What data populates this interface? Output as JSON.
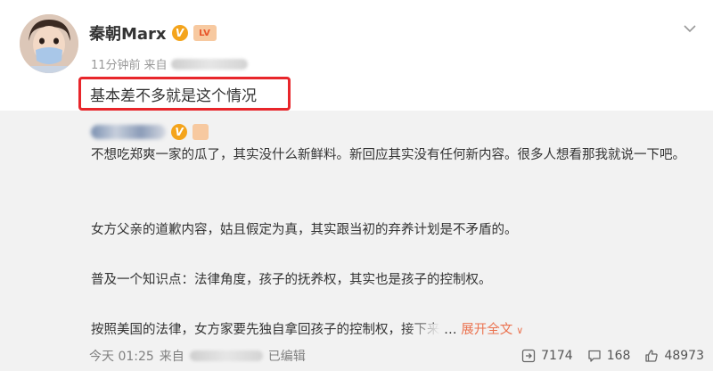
{
  "post": {
    "author": "秦朝Marx",
    "verified_badge": "V",
    "level_badge": "LV",
    "time": "11分钟前",
    "source_prefix": "来自",
    "text": "基本差不多就是这个情况",
    "menu_icon": "chevron-down-icon"
  },
  "repost": {
    "author_badge": "V",
    "paragraphs": [
      "不想吃郑爽一家的瓜了，其实没什么新鲜料。新回应其实没有任何新内容。很多人想看那我就说一下吧。",
      "女方父亲的道歉内容，姑且假定为真，其实跟当初的弃养计划是不矛盾的。",
      "普及一个知识点：法律角度，孩子的抚养权，其实也是孩子的控制权。",
      "按照美国的法律，女方家要先独自拿回孩子的控制权，接下来"
    ],
    "expand_label": "展开全文",
    "footer": {
      "time": "今天 01:25",
      "source_prefix": "来自",
      "edited_label": "已编辑",
      "reposts": "7174",
      "comments": "168",
      "likes": "48973"
    }
  },
  "colors": {
    "highlight_border": "#e8262b",
    "expand_link": "#eb7350",
    "repost_bg": "#f2f2f2"
  }
}
